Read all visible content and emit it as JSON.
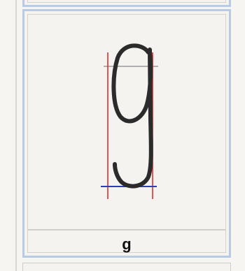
{
  "glyph": {
    "character": "g",
    "label": "g"
  },
  "colors": {
    "guide_vertical": "#e02020",
    "guide_baseline": "#2a3fb0",
    "guide_xheight": "#9a9a9a",
    "stroke": "#2b2b2b",
    "panel_border": "#b7cbe6"
  }
}
